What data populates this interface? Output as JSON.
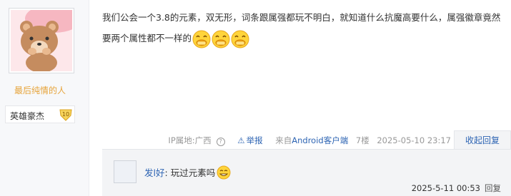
{
  "author": {
    "name": "最后纯情的人",
    "badge_text": "英雄豪杰",
    "badge_level": "10"
  },
  "post": {
    "content": "我们公会一个3.8的元素，双无形，词条跟属强都玩不明白，就知道什么抗魔高要什么，属强徽章竟然要两个属性都不一样的",
    "emojis": [
      "laugh-cover-mouth-emoji",
      "laugh-cover-mouth-emoji",
      "laugh-cover-mouth-emoji"
    ]
  },
  "meta": {
    "ip_location": "IP属地:广西",
    "help_icon": "?",
    "report": "举报",
    "client_prefix": "来自",
    "client": "Android客户端",
    "floor": "7楼",
    "datetime": "2025-05-10 23:17",
    "collapse_reply": "收起回复"
  },
  "reply": {
    "user": "发l好",
    "separator": ":",
    "content": "玩过元素吗",
    "emoji": "grin-emoji",
    "datetime": "2025-5-11 00:53",
    "reply_label": "回复"
  },
  "colors": {
    "link": "#2d64b3",
    "username": "#e7a43b",
    "meta_gray": "#999999",
    "sidebar_bg": "#f7f8fa",
    "reply_bg": "#f3f4f6"
  }
}
